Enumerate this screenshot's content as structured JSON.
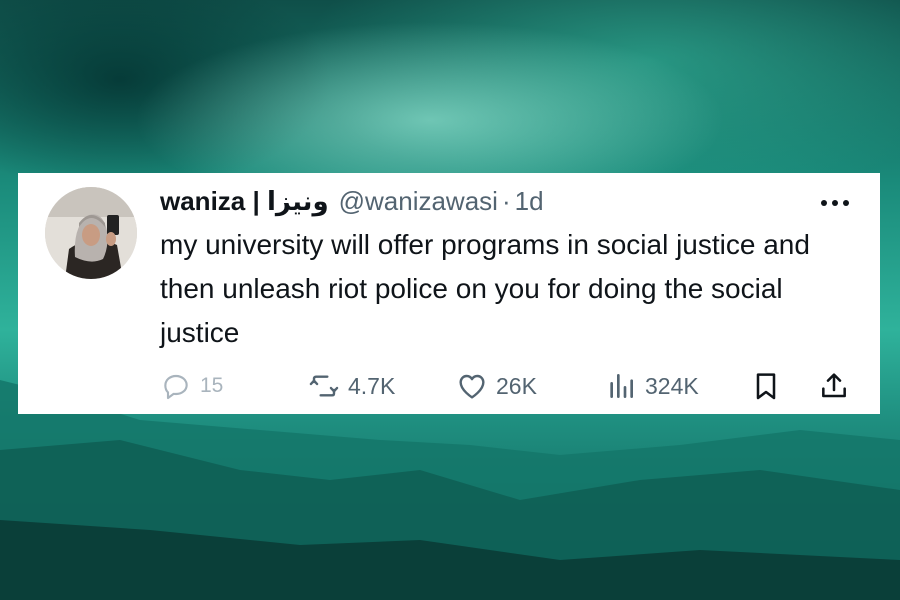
{
  "tweet": {
    "display_name": "waniza | ونيزا",
    "handle": "@wanizawasi",
    "separator": "·",
    "time": "1d",
    "text": "my university will offer programs in social justice and then unleash riot police on you for doing the social justice",
    "more_icon": "more-horizontal-icon",
    "actions": {
      "replies": "15",
      "retweets": "4.7K",
      "likes": "26K",
      "views": "324K"
    }
  },
  "colors": {
    "text_primary": "#0f1419",
    "text_secondary": "#536471",
    "card": "#ffffff",
    "background": "#1a8a7a"
  }
}
